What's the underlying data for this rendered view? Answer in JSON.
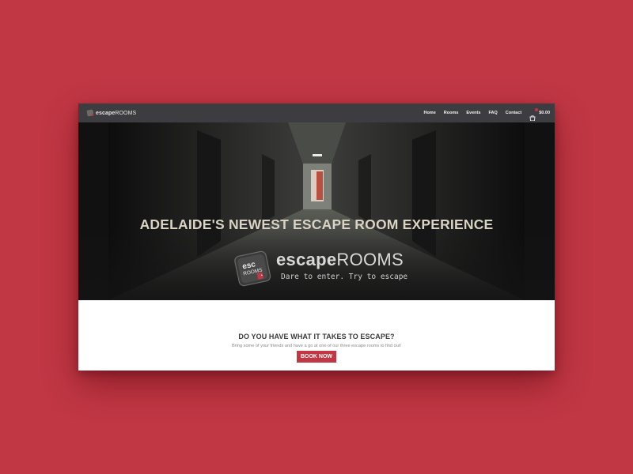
{
  "nav": {
    "brand_prefix": "escape",
    "brand_suffix": "ROOMS",
    "links": [
      "Home",
      "Rooms",
      "Events",
      "FAQ",
      "Contact"
    ],
    "cart_total": "$0.00"
  },
  "hero": {
    "title": "ADELAIDE'S NEWEST ESCAPE ROOM EXPERIENCE",
    "logo_prefix": "escape",
    "logo_suffix": "ROOMS",
    "badge_top": "esc",
    "badge_bottom": "ROOMS",
    "tagline": "Dare to enter. Try to escape"
  },
  "cta": {
    "heading": "DO YOU HAVE WHAT IT TAKES TO ESCAPE?",
    "subtext": "Bring some of your friends and have a go at one of our three escape rooms to find out!",
    "button_label": "BOOK NOW"
  },
  "colors": {
    "brand_red": "#c13744",
    "nav_bg": "#3d3d41"
  }
}
